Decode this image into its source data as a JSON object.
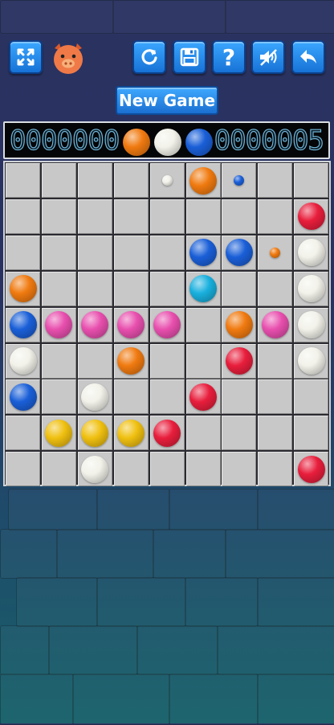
{
  "toolbar": {
    "fullscreen_icon": "fullscreen-icon",
    "avatar_icon": "pig-face-icon",
    "restart_icon": "restart-icon",
    "save_icon": "save-icon",
    "help_label": "?",
    "sound_icon": "muted-speaker-icon",
    "back_icon": "back-arrow-icon"
  },
  "new_game_label": "New Game",
  "score": {
    "left": "0000000",
    "right": "0000005"
  },
  "colors": {
    "orange": "#f07a10",
    "white": "#f2f2ea",
    "blue": "#1a5fd8",
    "red": "#e81e3c",
    "pink": "#e84fae",
    "cyan": "#19b0de",
    "yellow": "#f0c010",
    "cell": "#c8c8c8",
    "button": "#1f88ee"
  },
  "next_balls": [
    "orange",
    "white",
    "blue"
  ],
  "board": {
    "rows": 9,
    "cols": 9,
    "balls": [
      {
        "row": 0,
        "col": 4,
        "color": "white",
        "size": "small"
      },
      {
        "row": 0,
        "col": 5,
        "color": "orange",
        "size": "big"
      },
      {
        "row": 0,
        "col": 6,
        "color": "blue",
        "size": "small"
      },
      {
        "row": 1,
        "col": 8,
        "color": "red",
        "size": "big"
      },
      {
        "row": 2,
        "col": 5,
        "color": "blue",
        "size": "big"
      },
      {
        "row": 2,
        "col": 6,
        "color": "blue",
        "size": "big"
      },
      {
        "row": 2,
        "col": 7,
        "color": "orange",
        "size": "small"
      },
      {
        "row": 2,
        "col": 8,
        "color": "white",
        "size": "big"
      },
      {
        "row": 3,
        "col": 0,
        "color": "orange",
        "size": "big"
      },
      {
        "row": 3,
        "col": 5,
        "color": "cyan",
        "size": "big"
      },
      {
        "row": 3,
        "col": 8,
        "color": "white",
        "size": "big"
      },
      {
        "row": 4,
        "col": 0,
        "color": "blue",
        "size": "big"
      },
      {
        "row": 4,
        "col": 1,
        "color": "pink",
        "size": "big"
      },
      {
        "row": 4,
        "col": 2,
        "color": "pink",
        "size": "big"
      },
      {
        "row": 4,
        "col": 3,
        "color": "pink",
        "size": "big"
      },
      {
        "row": 4,
        "col": 4,
        "color": "pink",
        "size": "big"
      },
      {
        "row": 4,
        "col": 6,
        "color": "orange",
        "size": "big"
      },
      {
        "row": 4,
        "col": 7,
        "color": "pink",
        "size": "big"
      },
      {
        "row": 4,
        "col": 8,
        "color": "white",
        "size": "big"
      },
      {
        "row": 5,
        "col": 0,
        "color": "white",
        "size": "big"
      },
      {
        "row": 5,
        "col": 3,
        "color": "orange",
        "size": "big"
      },
      {
        "row": 5,
        "col": 6,
        "color": "red",
        "size": "big"
      },
      {
        "row": 5,
        "col": 8,
        "color": "white",
        "size": "big"
      },
      {
        "row": 6,
        "col": 0,
        "color": "blue",
        "size": "big"
      },
      {
        "row": 6,
        "col": 2,
        "color": "white",
        "size": "big"
      },
      {
        "row": 6,
        "col": 5,
        "color": "red",
        "size": "big"
      },
      {
        "row": 7,
        "col": 1,
        "color": "yellow",
        "size": "big"
      },
      {
        "row": 7,
        "col": 2,
        "color": "yellow",
        "size": "big"
      },
      {
        "row": 7,
        "col": 3,
        "color": "yellow",
        "size": "big"
      },
      {
        "row": 7,
        "col": 4,
        "color": "red",
        "size": "big"
      },
      {
        "row": 8,
        "col": 2,
        "color": "white",
        "size": "big"
      },
      {
        "row": 8,
        "col": 8,
        "color": "red",
        "size": "big"
      }
    ]
  }
}
